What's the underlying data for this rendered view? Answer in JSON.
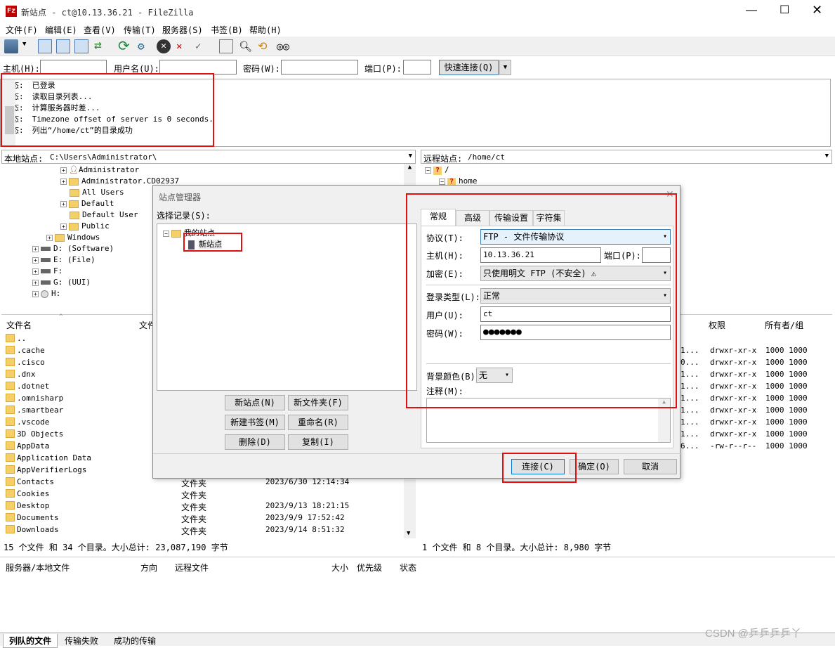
{
  "window": {
    "title": "新站点 - ct@10.13.36.21 - FileZilla",
    "app_icon": "filezilla-icon"
  },
  "menu": [
    "文件(F)",
    "编辑(E)",
    "查看(V)",
    "传输(T)",
    "服务器(S)",
    "书签(B)",
    "帮助(H)"
  ],
  "quickconnect": {
    "host_label": "主机(H):",
    "user_label": "用户名(U):",
    "pass_label": "密码(W):",
    "port_label": "端口(P):",
    "button": "快速连接(Q)"
  },
  "log": [
    {
      "k": "状态:",
      "v": "已登录"
    },
    {
      "k": "状态:",
      "v": "读取目录列表..."
    },
    {
      "k": "状态:",
      "v": "计算服务器时差..."
    },
    {
      "k": "状态:",
      "v": "Timezone offset of server is 0 seconds."
    },
    {
      "k": "状态:",
      "v": "列出“/home/ct”的目录成功"
    }
  ],
  "local": {
    "label": "本地站点:",
    "path": "C:\\Users\\Administrator\\",
    "tree": [
      "Administrator",
      "Administrator.CD02937",
      "All Users",
      "Default",
      "Default User",
      "Public",
      "Windows",
      "D: (Software)",
      "E: (File)",
      "F:",
      "G: (UUI)",
      "H:"
    ],
    "col_name": "文件名",
    "col_size": "文件",
    "files": [
      {
        "n": "..",
        "t": "",
        "d": ""
      },
      {
        "n": ".cache",
        "t": "",
        "d": ""
      },
      {
        "n": ".cisco",
        "t": "",
        "d": ""
      },
      {
        "n": ".dnx",
        "t": "",
        "d": ""
      },
      {
        "n": ".dotnet",
        "t": "",
        "d": ""
      },
      {
        "n": ".omnisharp",
        "t": "",
        "d": ""
      },
      {
        "n": ".smartbear",
        "t": "",
        "d": ""
      },
      {
        "n": ".vscode",
        "t": "",
        "d": ""
      },
      {
        "n": "3D Objects",
        "t": "",
        "d": ""
      },
      {
        "n": "AppData",
        "t": "",
        "d": ""
      },
      {
        "n": "Application Data",
        "t": "",
        "d": ""
      },
      {
        "n": "AppVerifierLogs",
        "t": "",
        "d": ""
      },
      {
        "n": "Contacts",
        "t": "文件夹",
        "d": "2023/6/30 12:14:34"
      },
      {
        "n": "Cookies",
        "t": "文件夹",
        "d": ""
      },
      {
        "n": "Desktop",
        "t": "文件夹",
        "d": "2023/9/13 18:21:15"
      },
      {
        "n": "Documents",
        "t": "文件夹",
        "d": "2023/9/9 17:52:42"
      },
      {
        "n": "Downloads",
        "t": "文件夹",
        "d": "2023/9/14 8:51:32"
      }
    ],
    "status": "15 个文件 和 34 个目录。大小总计: 23,087,190 字节"
  },
  "remote": {
    "label": "远程站点:",
    "path": "/home/ct",
    "tree": [
      "/",
      "home"
    ],
    "col_perm": "权限",
    "col_owner": "所有者/组",
    "rows": [
      {
        "c": "1...",
        "p": "drwxr-xr-x",
        "o": "1000 1000"
      },
      {
        "c": "0...",
        "p": "drwxr-xr-x",
        "o": "1000 1000"
      },
      {
        "c": "1...",
        "p": "drwxr-xr-x",
        "o": "1000 1000"
      },
      {
        "c": "1...",
        "p": "drwxr-xr-x",
        "o": "1000 1000"
      },
      {
        "c": "1...",
        "p": "drwxr-xr-x",
        "o": "1000 1000"
      },
      {
        "c": "1...",
        "p": "drwxr-xr-x",
        "o": "1000 1000"
      },
      {
        "c": "1...",
        "p": "drwxr-xr-x",
        "o": "1000 1000"
      },
      {
        "c": "1...",
        "p": "drwxr-xr-x",
        "o": "1000 1000"
      },
      {
        "c": "6...",
        "p": "-rw-r--r--",
        "o": "1000 1000"
      }
    ],
    "status": "1 个文件 和 8 个目录。大小总计: 8,980 字节"
  },
  "queue": {
    "cols": [
      "服务器/本地文件",
      "方向",
      "远程文件",
      "大小",
      "优先级",
      "状态"
    ],
    "tabs": [
      "列队的文件",
      "传输失败",
      "成功的传输"
    ]
  },
  "dialog": {
    "title": "站点管理器",
    "select_label": "选择记录(S):",
    "root": "我的站点",
    "site": "新站点",
    "buttons": {
      "new_site": "新站点(N)",
      "new_folder": "新文件夹(F)",
      "new_bookmark": "新建书签(M)",
      "rename": "重命名(R)",
      "delete": "删除(D)",
      "copy": "复制(I)",
      "connect": "连接(C)",
      "ok": "确定(O)",
      "cancel": "取消"
    },
    "tabs": [
      "常规",
      "高级",
      "传输设置",
      "字符集"
    ],
    "protocol_label": "协议(T):",
    "protocol": "FTP - 文件传输协议",
    "host_label": "主机(H):",
    "host": "10.13.36.21",
    "port_label": "端口(P):",
    "port": "",
    "enc_label": "加密(E):",
    "enc": "只使用明文 FTP (不安全) ⚠",
    "logon_label": "登录类型(L):",
    "logon": "正常",
    "user_label": "用户(U):",
    "user": "ct",
    "pass_label": "密码(W):",
    "pass": "●●●●●●●",
    "bg_label": "背景颜色(B)",
    "bg": "无",
    "comment_label": "注释(M):"
  },
  "watermark": "CSDN @乒乒乒乒丫"
}
